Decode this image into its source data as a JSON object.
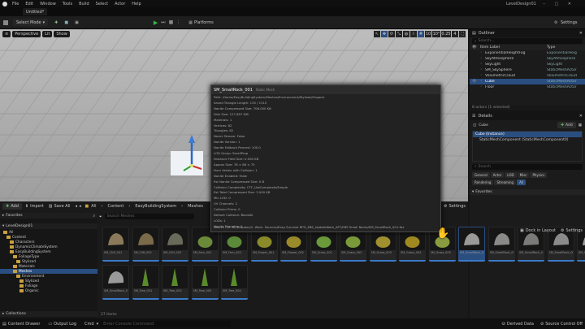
{
  "menu": [
    "File",
    "Edit",
    "Window",
    "Tools",
    "Build",
    "Select",
    "Actor",
    "Help"
  ],
  "window_title": "LevelDesign01",
  "level_tab": "Untitled*",
  "toolbar": {
    "select_mode": "Select Mode",
    "platforms": "Platforms",
    "settings": "Settings"
  },
  "viewport": {
    "perspective": "Perspective",
    "lit": "Lit",
    "show": "Show",
    "snap_grid": "10",
    "snap_rot": "10°",
    "snap_scale": "0.25",
    "cam_speed": "4"
  },
  "outliner": {
    "title": "Outliner",
    "search_placeholder": "Search...",
    "col_label": "Item Label",
    "col_type": "Type",
    "items": [
      {
        "label": "ExponentialHeightFog",
        "type": "ExponentialHeig"
      },
      {
        "label": "SkyAtmosphere",
        "type": "SkyAtmosphere"
      },
      {
        "label": "SkyLight",
        "type": "SkyLight"
      },
      {
        "label": "SM_SkySphere",
        "type": "StaticMeshActor"
      },
      {
        "label": "VolumetricCloud",
        "type": "VolumetricCloud"
      },
      {
        "label": "Cube",
        "type": "StaticMeshActor"
      },
      {
        "label": "Floor",
        "type": "StaticMeshActor"
      }
    ],
    "count": "8 actors (1 selected)"
  },
  "details": {
    "title": "Details",
    "object": "Cube",
    "add": "Add",
    "instance": "Cube (Instance)",
    "component": "StaticMeshComponent (StaticMeshComponent0)",
    "search_placeholder": "Search",
    "filters_row1": [
      "General",
      "Actor",
      "LOD",
      "Misc",
      "Physics"
    ],
    "filters_row2": [
      "Rendering",
      "Streaming",
      "All"
    ],
    "section": "Favorites",
    "dock": "Dock in Layout",
    "settings": "Settings"
  },
  "content_browser": {
    "add": "Add",
    "import": "Import",
    "save_all": "Save All",
    "breadcrumb": [
      "All",
      "Content",
      "EasyBuildingSystem",
      "Meshes"
    ],
    "settings": "Settings",
    "favorites": "Favorites",
    "root": "LevelDesign01",
    "tree": [
      {
        "label": "All",
        "depth": 0
      },
      {
        "label": "Content",
        "depth": 1
      },
      {
        "label": "Characters",
        "depth": 2
      },
      {
        "label": "DynamicClimateSystem",
        "depth": 2
      },
      {
        "label": "EasyBuildingSystem",
        "depth": 2
      },
      {
        "label": "FoliageType",
        "depth": 3
      },
      {
        "label": "Stylized",
        "depth": 4
      },
      {
        "label": "Materials",
        "depth": 3
      },
      {
        "label": "Meshes",
        "depth": 3
      },
      {
        "label": "Environment",
        "depth": 4
      },
      {
        "label": "Stylized",
        "depth": 5
      },
      {
        "label": "Foliage",
        "depth": 5
      },
      {
        "label": "Organic",
        "depth": 5
      }
    ],
    "search_placeholder": "Search Meshes",
    "item_count": "27 items",
    "collections": "Collections",
    "row1": [
      "SM_Cliff_001",
      "SM_Cliff_002",
      "SM_Cliff_003",
      "SM_Fern_001",
      "SM_Fern_002",
      "SM_Flower_001",
      "SM_Flower_002",
      "SM_Grass_001",
      "SM_Grass_002",
      "SM_Grass_003",
      "SM_Grass_004",
      "SM_Grass_005",
      "SM_SmallRock_001",
      "SM_SmallRock_002",
      "SM_SmallRock_003",
      "SM_SmallRock_004",
      "SM_SmallRock_005"
    ],
    "row2": [
      "SM_SmallRock_006",
      "SM_Tree_001",
      "SM_Tree_002",
      "SM_Tree_003",
      "SM_Tree_004"
    ]
  },
  "tooltip": {
    "title": "SM_SmallRock_001",
    "type": "Static Mesh",
    "lines": [
      "Path: /Game/EasyBuildingSystem/Meshes/Environment/Stylized/Organic",
      "Saved Triangle Length: 135 / 1310",
      "Nanite Compressed Size: 706.000 KB",
      "Disk Size: 127.897 KiB",
      "Materials: 1",
      "Vertices: 82",
      "Triangles: 82",
      "Never Stream: False",
      "Nanite Version: 1",
      "Nanite Fallback Percent: 100.0",
      "LOD Group: SmallProp",
      "Distance Field Size: 0.000 KB",
      "Approx Size: 78 × 88 × 75",
      "Num Vertex with Collision: 1",
      "Nanite Enabled: False",
      "Est Nanite Compressed Size: 0 B",
      "Collision Complexity: CTF_UseComplexAsSimple",
      "Est Total Compressed Size: 3.000 KB",
      "Min LOD: 0",
      "UV Channels: 2",
      "Collision Prims: 0",
      "Default Collision: BlockAll",
      "LODs: 1",
      "Nanite Triangles: 0"
    ],
    "source": "Source File: D:/Dropbox/2. Work. Sources/Easy Survival RPG_EBS_UpdateWork_AFT/EBS Small Rocks/SM_SmallRock_001.fbx"
  },
  "status": {
    "content_drawer": "Content Drawer",
    "output_log": "Output Log",
    "cmd": "Cmd",
    "console_placeholder": "Enter Console Command",
    "derived": "Derived Data",
    "source_control": "Source Control Off"
  }
}
